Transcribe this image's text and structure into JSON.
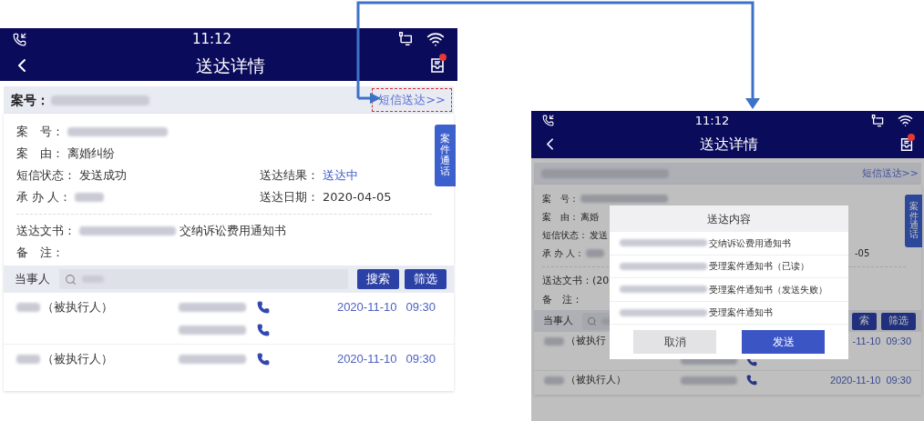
{
  "detail_screen": {
    "status_time": "11:12",
    "title": "送达详情",
    "mail_badge": true,
    "case_header": {
      "label": "案号：",
      "redacted": true,
      "link": "短信送达>>",
      "link_highlighted": true
    },
    "side_tab": "案件通话",
    "info_rows": [
      [
        {
          "label": "案　号：",
          "redacted": true
        }
      ],
      [
        {
          "label": "案　由：",
          "value": "离婚纠纷"
        }
      ],
      [
        {
          "label": "短信状态：",
          "value": "发送成功"
        },
        {
          "label": "送达结果：",
          "value": "送达中",
          "accent": true
        }
      ],
      [
        {
          "label": "承 办 人：",
          "redacted": true
        },
        {
          "label": "送达日期：",
          "value": "2020-04-05"
        }
      ]
    ],
    "document": {
      "label": "送达文书：",
      "redacted": true,
      "value": "交纳诉讼费用通知书"
    },
    "remark_label": "备　注：",
    "parties": {
      "label": "当事人",
      "search_redacted": true,
      "buttons": [
        "搜索",
        "筛选"
      ],
      "rows": [
        {
          "name_redacted": true,
          "role": "（被执行人）",
          "phones": [
            {
              "redacted": true
            },
            {
              "redacted": true
            }
          ],
          "date": "2020-11-10",
          "time": "09:30"
        },
        {
          "name_redacted": true,
          "role": "（被执行人）",
          "phones": [
            {
              "redacted": true
            }
          ],
          "date": "2020-11-10",
          "time": "09:30"
        }
      ]
    }
  },
  "dialog_screen": {
    "status_time": "11:12",
    "title": "送达详情",
    "mail_badge": true,
    "header_link": "短信送达>>",
    "side_tab": "案件通话",
    "info_rows": [
      {
        "label": "案　号：",
        "redacted": true
      },
      {
        "label": "案　由：",
        "value": "离婚"
      },
      {
        "label": "短信状态：",
        "value": "发送"
      },
      {
        "label": "承 办 人：",
        "redacted": true,
        "tail": "-05"
      }
    ],
    "document_label": "送达文书：(20",
    "remark_label": "备　注：",
    "parties": {
      "label": "当事人",
      "search_redacted": true,
      "buttons": [
        "索",
        "筛选"
      ],
      "lines": [
        {
          "name_redacted": true,
          "role": "（被执行",
          "date": "-11-10",
          "time": "09:30"
        },
        {
          "phone_redacted": true
        },
        {
          "name_redacted": true,
          "role": "（被执行人）",
          "phone_redacted": true,
          "date": "2020-11-10",
          "time": "09:30"
        }
      ]
    },
    "dialog": {
      "title": "送达内容",
      "items": [
        {
          "redacted": true,
          "value": "交纳诉讼费用通知书"
        },
        {
          "redacted": true,
          "value": "受理案件通知书（已读）"
        },
        {
          "redacted": true,
          "value": "受理案件通知书（发送失败）"
        },
        {
          "redacted": true,
          "value": "受理案件通知书"
        }
      ],
      "buttons": [
        {
          "label": "取消",
          "kind": "cancel"
        },
        {
          "label": "发送",
          "kind": "confirm"
        }
      ]
    }
  }
}
